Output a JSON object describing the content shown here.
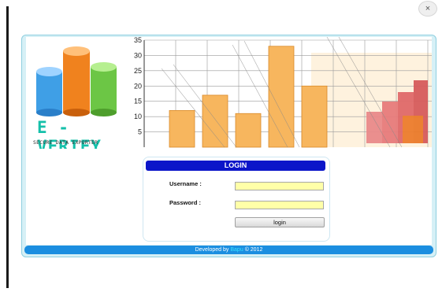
{
  "window": {
    "close_glyph": "×"
  },
  "logo": {
    "title": "E - VERIFY",
    "tagline": "SECURE DATA EXPORTER",
    "icon": "three-cylinders-logo",
    "colors": {
      "blue": "#3f9fe6",
      "orange": "#f0821e",
      "green": "#6cc645",
      "title": "#15c0aa"
    }
  },
  "banner_chart": {
    "y_ticks": [
      "35",
      "30",
      "25",
      "20",
      "15",
      "10",
      "5"
    ],
    "bars": [
      12,
      17,
      11,
      33,
      20
    ]
  },
  "login": {
    "header": "LOGIN",
    "username_label": "Username :",
    "password_label": "Password :",
    "username_value": "",
    "password_value": "",
    "button_label": "login"
  },
  "footer": {
    "prefix": "Developed by",
    "brand": "Bapu",
    "suffix": "© 2012"
  },
  "colors": {
    "header_blue": "#0b15c9",
    "footer_blue": "#1b8ee0",
    "input_yellow": "#ffffa8"
  }
}
